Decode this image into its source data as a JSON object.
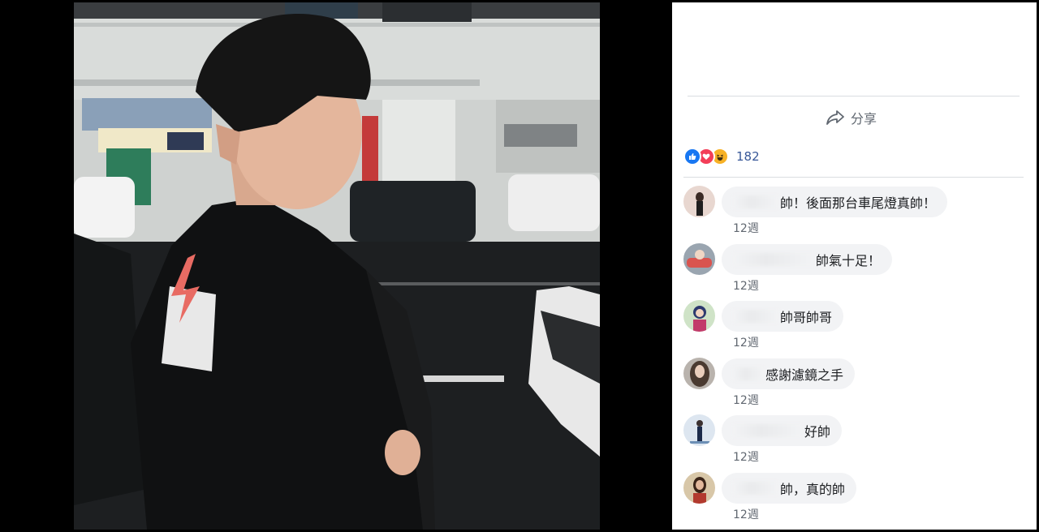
{
  "viewer": {
    "photo_alt": ""
  },
  "panel": {
    "share_label": "分享",
    "reactions": {
      "icons": [
        "like-icon",
        "love-icon",
        "haha-icon"
      ],
      "count": "182"
    },
    "comments": [
      {
        "text": "帥！後面那台車尾燈真帥！",
        "time": "12週"
      },
      {
        "text": "帥氣十足！",
        "time": "12週"
      },
      {
        "text": "帥哥帥哥",
        "time": "12週"
      },
      {
        "text": "感謝濾鏡之手",
        "time": "12週"
      },
      {
        "text": "好帥",
        "time": "12週"
      },
      {
        "text": "帥，真的帥",
        "time": "12週"
      }
    ]
  },
  "colors": {
    "link": "#385898",
    "muted": "#606770",
    "bubble": "#f2f3f5",
    "like": "#1877f2",
    "love": "#f33e58",
    "haha": "#f7b125"
  }
}
